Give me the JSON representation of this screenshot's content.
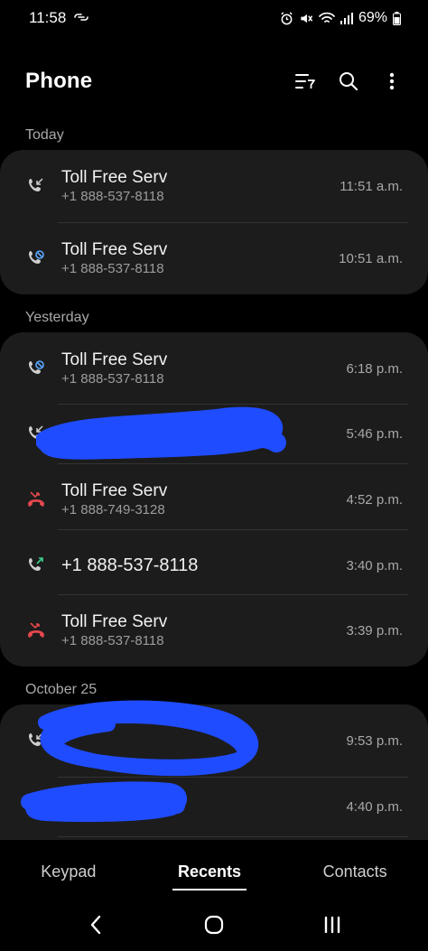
{
  "status_bar": {
    "time": "11:58",
    "battery": "69%"
  },
  "header": {
    "title": "Phone"
  },
  "sections": [
    {
      "label": "Today",
      "calls": [
        {
          "type": "incoming",
          "name": "Toll Free Serv",
          "number": "+1 888-537-8118",
          "time": "11:51 a.m."
        },
        {
          "type": "blocked",
          "name": "Toll Free Serv",
          "number": "+1 888-537-8118",
          "time": "10:51 a.m."
        }
      ]
    },
    {
      "label": "Yesterday",
      "calls": [
        {
          "type": "blocked",
          "name": "Toll Free Serv",
          "number": "+1 888-537-8118",
          "time": "6:18 p.m."
        },
        {
          "type": "incoming",
          "name": "",
          "number": "",
          "time": "5:46 p.m."
        },
        {
          "type": "missed",
          "name": "Toll Free Serv",
          "number": "+1 888-749-3128",
          "time": "4:52 p.m."
        },
        {
          "type": "outgoing",
          "name": "+1 888-537-8118",
          "number": "",
          "time": "3:40 p.m."
        },
        {
          "type": "missed",
          "name": "Toll Free Serv",
          "number": "+1 888-537-8118",
          "time": "3:39 p.m."
        }
      ]
    },
    {
      "label": "October 25",
      "calls": [
        {
          "type": "incoming",
          "name": "",
          "number": "",
          "time": "9:53 p.m."
        },
        {
          "type": "incoming",
          "name": "",
          "number": "",
          "time": "4:40 p.m."
        }
      ]
    }
  ],
  "tabs": {
    "keypad": "Keypad",
    "recents": "Recents",
    "contacts": "Contacts"
  },
  "colors": {
    "background": "#000000",
    "card": "#1c1c1c",
    "missed": "#e5484d",
    "outgoing": "#3ecf8e",
    "blocked": "#5aa9ff",
    "redaction": "#1f4cff"
  },
  "icons": {
    "incoming": "incoming-call-icon",
    "blocked": "blocked-call-icon",
    "missed": "missed-call-icon",
    "outgoing": "outgoing-call-icon"
  }
}
